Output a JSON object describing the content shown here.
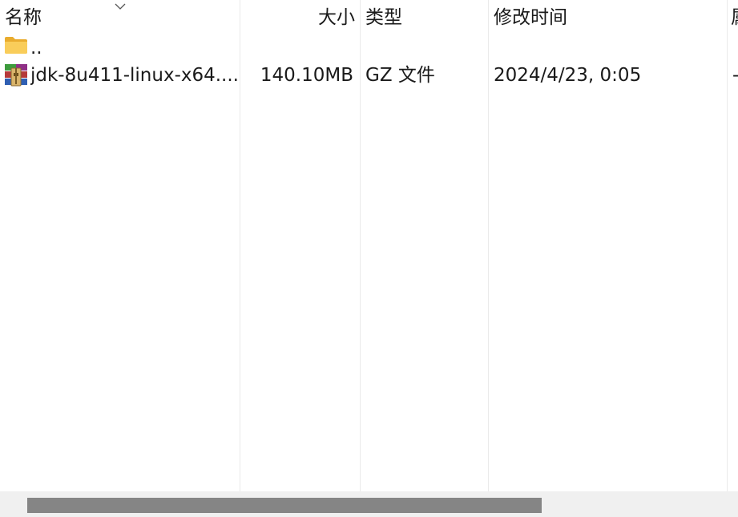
{
  "columns": {
    "name": "名称",
    "size": "大小",
    "type": "类型",
    "modified": "修改时间",
    "attributes": "属"
  },
  "sort": {
    "column": "name",
    "icon": "chevron-down-icon"
  },
  "rows": [
    {
      "icon": "folder-icon",
      "name": "..",
      "size": "",
      "type": "",
      "modified": "",
      "attributes": ""
    },
    {
      "icon": "archive-icon",
      "name": "jdk-8u411-linux-x64....",
      "size": "140.10MB",
      "type": "GZ 文件",
      "modified": "2024/4/23, 0:05",
      "attributes": "-"
    }
  ],
  "colors": {
    "folder": "#f6c34a",
    "scrollbar_track": "#f0f0f0",
    "scrollbar_thumb": "#858585"
  }
}
